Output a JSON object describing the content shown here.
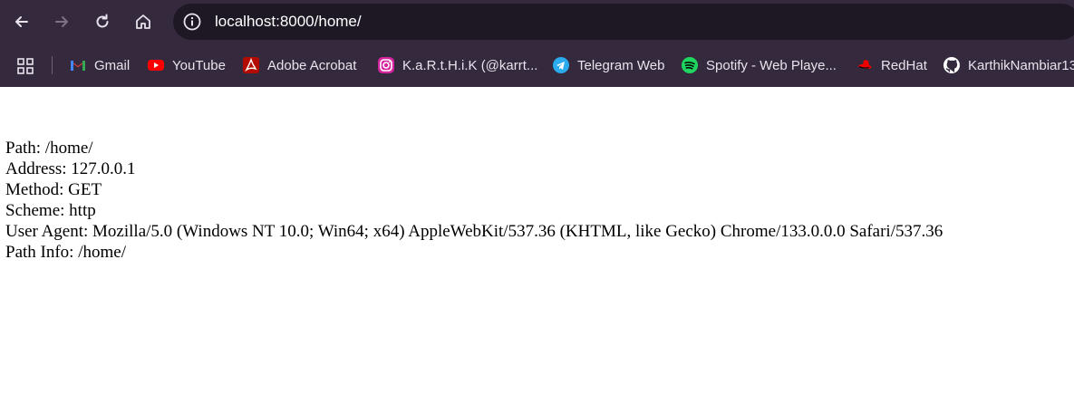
{
  "browser": {
    "url": "localhost:8000/home/",
    "bookmarks": [
      {
        "label": "Gmail",
        "icon": "gmail-icon"
      },
      {
        "label": "YouTube",
        "icon": "youtube-icon"
      },
      {
        "label": "Adobe Acrobat",
        "icon": "adobe-acrobat-icon"
      },
      {
        "label": "K.a.R.t.H.i.K (@karrt...",
        "icon": "instagram-icon"
      },
      {
        "label": "Telegram Web",
        "icon": "telegram-icon"
      },
      {
        "label": "Spotify - Web Playe...",
        "icon": "spotify-icon"
      },
      {
        "label": "RedHat",
        "icon": "redhat-icon"
      },
      {
        "label": "KarthikNambiar13",
        "icon": "github-icon"
      }
    ],
    "colors": {
      "chrome": "#35293d",
      "omnibox": "#1e1824",
      "page": "#ffffff"
    }
  },
  "page": {
    "lines": [
      "Path: /home/",
      "Address: 127.0.0.1",
      "Method: GET",
      "Scheme: http",
      "User Agent: Mozilla/5.0 (Windows NT 10.0; Win64; x64) AppleWebKit/537.36 (KHTML, like Gecko) Chrome/133.0.0.0 Safari/537.36",
      "Path Info: /home/"
    ]
  }
}
